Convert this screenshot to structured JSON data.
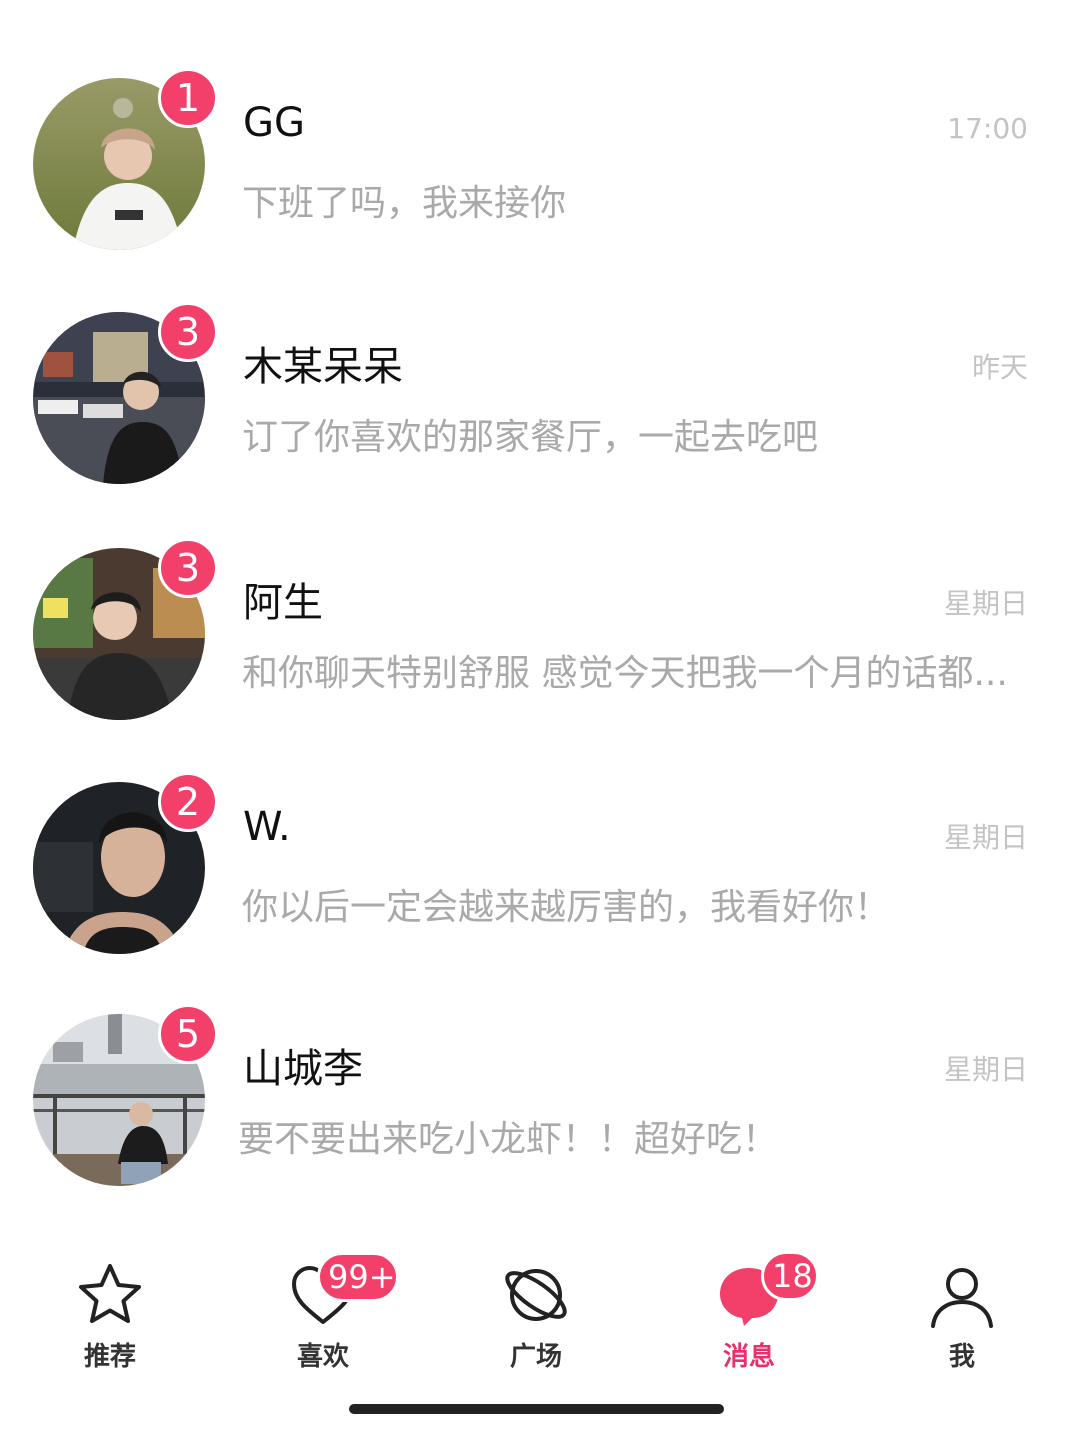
{
  "colors": {
    "accent": "#f2406a",
    "active_tab": "#e8316a",
    "preview_text": "#a9a9a9",
    "time_text": "#c4c4c4"
  },
  "chats": [
    {
      "name": "GG",
      "time": "17:00",
      "preview": "下班了吗，我来接你",
      "unread": "1"
    },
    {
      "name": "木某呆呆",
      "time": "昨天",
      "preview": "订了你喜欢的那家餐厅，一起去吃吧",
      "unread": "3"
    },
    {
      "name": "阿生",
      "time": "星期日",
      "preview": "和你聊天特别舒服 感觉今天把我一个月的话都...",
      "unread": "3"
    },
    {
      "name": "W.",
      "time": "星期日",
      "preview": "你以后一定会越来越厉害的，我看好你！",
      "unread": "2"
    },
    {
      "name": "山城李",
      "time": "星期日",
      "preview": "要不要出来吃小龙虾！！超好吃！",
      "unread": "5"
    }
  ],
  "tabs": [
    {
      "label": "推荐",
      "icon": "star-icon"
    },
    {
      "label": "喜欢",
      "icon": "heart-icon",
      "badge": "99+"
    },
    {
      "label": "广场",
      "icon": "planet-icon"
    },
    {
      "label": "消息",
      "icon": "chat-bubble-icon",
      "badge": "18",
      "active": true
    },
    {
      "label": "我",
      "icon": "person-icon"
    }
  ]
}
